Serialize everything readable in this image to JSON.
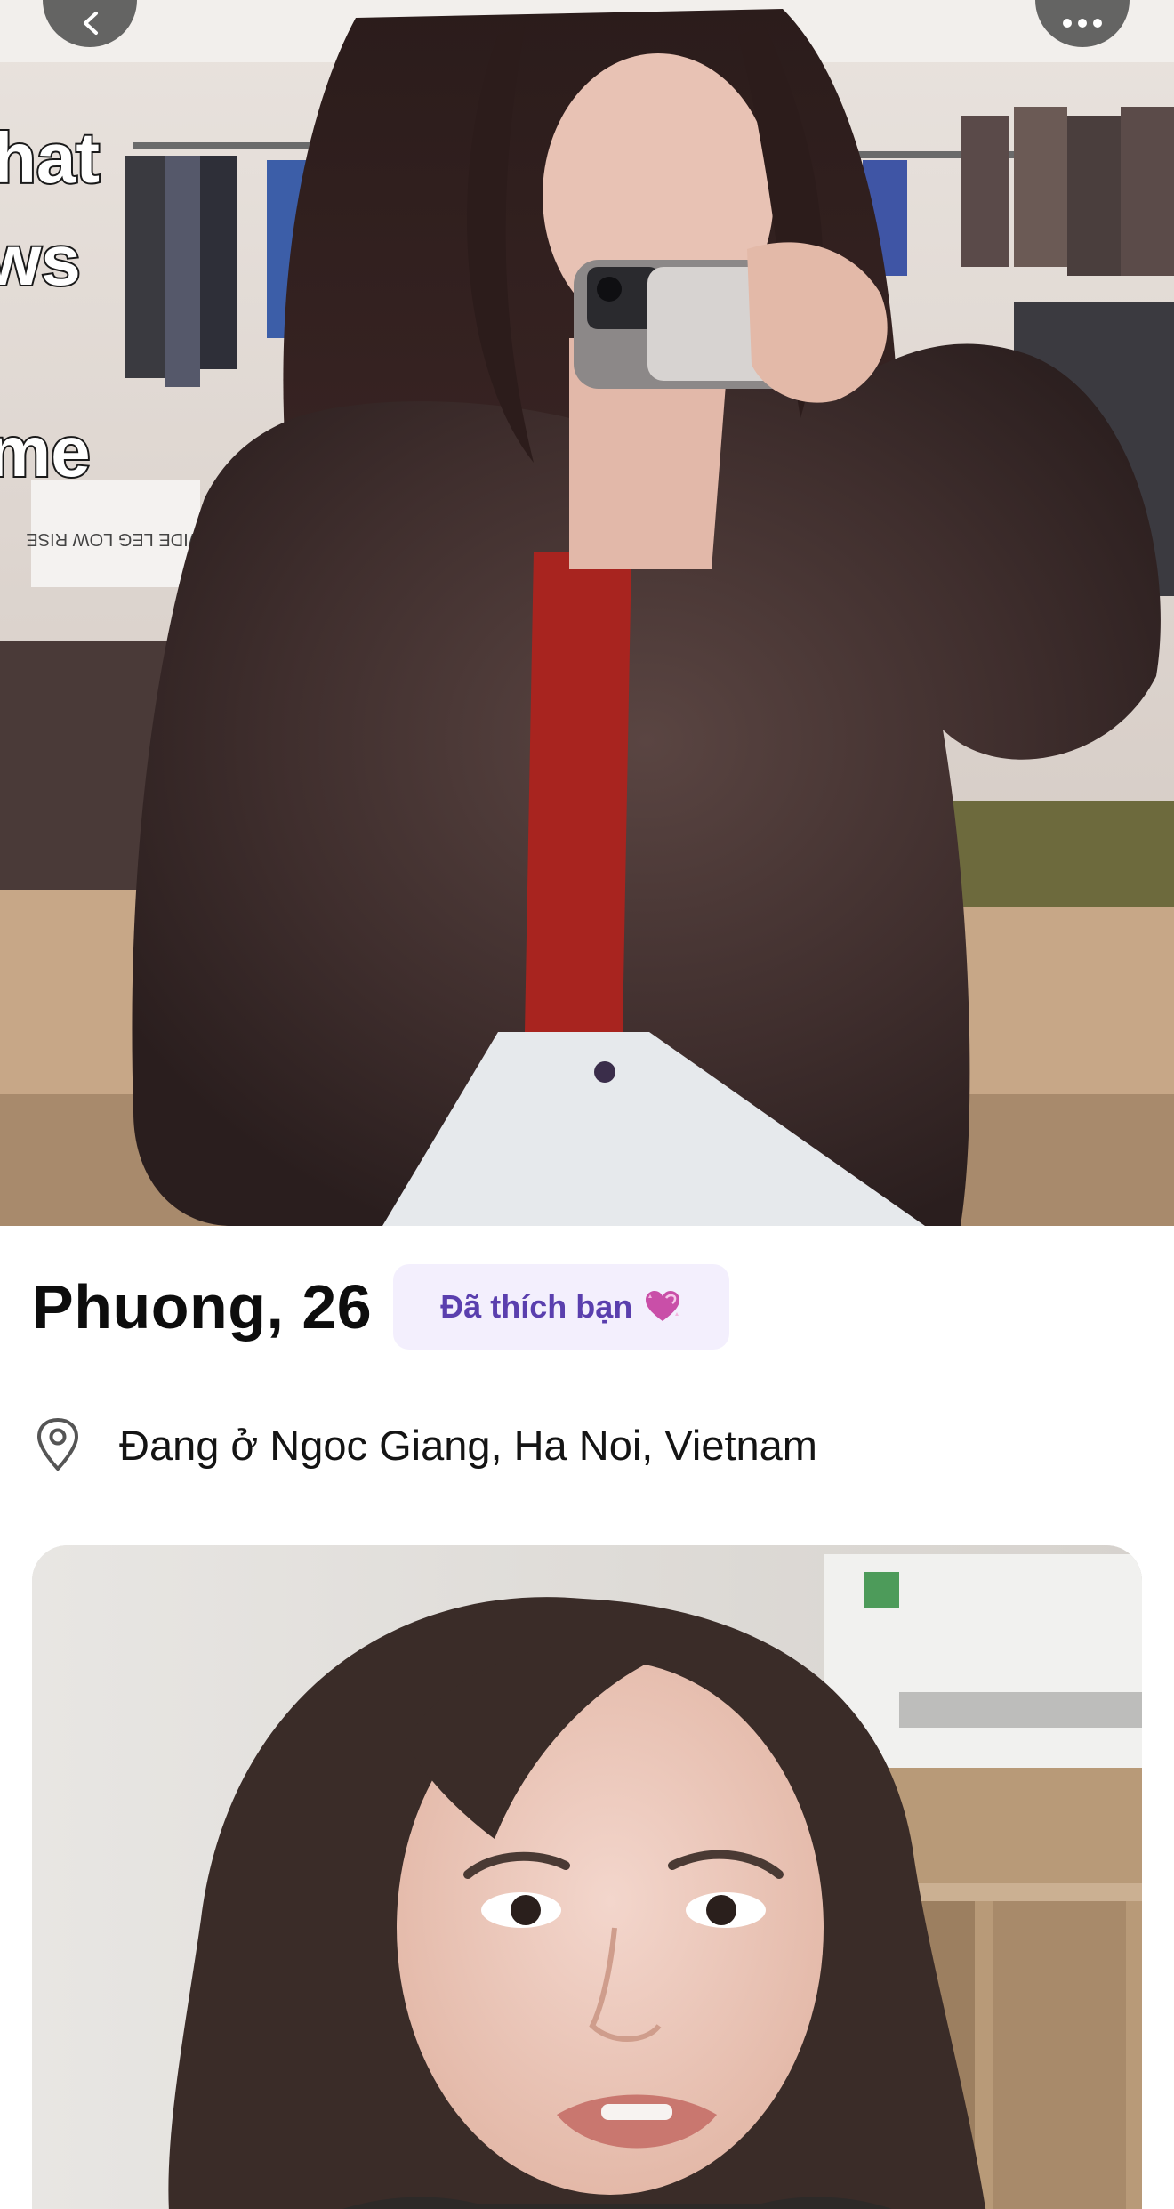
{
  "profile": {
    "name_age": "Phuong, 26",
    "liked_badge": "Đã thích bạn",
    "location": "Đang ở Ngoc Giang, Ha Noi, Vietnam"
  },
  "hero_photo": {
    "overlay_caption_lines": [
      "hat",
      "ws",
      "me"
    ],
    "sign_text": "WIDE LEG LOW RISE"
  },
  "colors": {
    "badge_background": "#f3effd",
    "badge_text": "#5a3fae",
    "nav_button": "#3c3c3c"
  },
  "icons": {
    "back": "chevron-left-icon",
    "more": "ellipsis-icon",
    "badge": "heart-sparkle-icon",
    "location": "map-pin-icon"
  }
}
